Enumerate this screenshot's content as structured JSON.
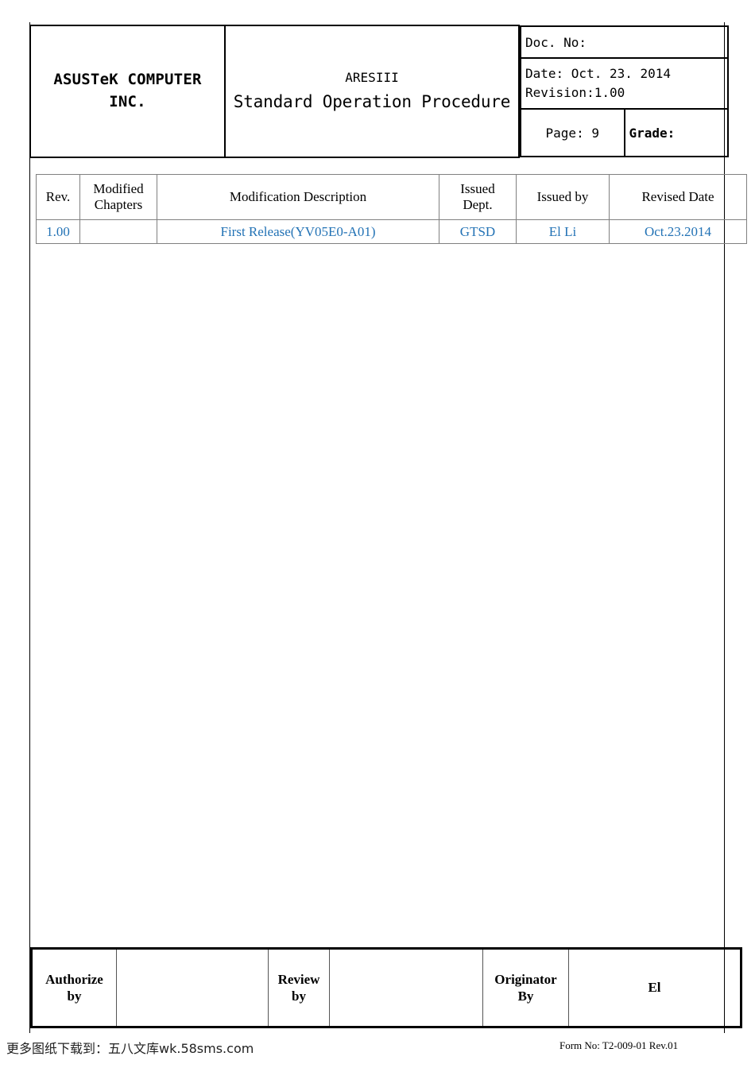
{
  "header": {
    "company": "ASUSTeK COMPUTER\nINC.",
    "company_line1": "ASUSTeK COMPUTER",
    "company_line2": "INC.",
    "product_title": "ARESIII",
    "document_type": "Standard Operation Procedure",
    "doc_no_label": "Doc. No:",
    "doc_no_value": "",
    "date_line": "Date: Oct. 23. 2014",
    "revision_line": "Revision:1.00",
    "page_label": "Page: 9",
    "grade_label": "Grade:",
    "grade_value": ""
  },
  "revision_table": {
    "columns": [
      "Rev.",
      "Modified Chapters",
      "Modification Description",
      "Issued Dept.",
      "Issued by",
      "Revised Date"
    ],
    "columns_split": [
      {
        "line1": "Rev.",
        "line2": ""
      },
      {
        "line1": "Modified",
        "line2": "Chapters"
      },
      {
        "line1": "Modification Description",
        "line2": ""
      },
      {
        "line1": "Issued",
        "line2": "Dept."
      },
      {
        "line1": "Issued by",
        "line2": ""
      },
      {
        "line1": "Revised Date",
        "line2": ""
      }
    ],
    "rows": [
      {
        "rev": "1.00",
        "modified_chapters": "",
        "description": "First Release(YV05E0-A01)",
        "issued_dept": "GTSD",
        "issued_by": "El Li",
        "revised_date": "Oct.23.2014"
      }
    ],
    "row_text_color": "#2272b5",
    "border_color": "#808080"
  },
  "signature_table": {
    "authorize_label": "Authorize by",
    "authorize_label_l1": "Authorize",
    "authorize_label_l2": "by",
    "authorize_value": "",
    "review_label": "Review by",
    "review_label_l1": "Review",
    "review_label_l2": "by",
    "review_value": "",
    "originator_label": "Originator By",
    "originator_label_l1": "Originator",
    "originator_label_l2": "By",
    "originator_value": "El"
  },
  "footer": {
    "watermark": "更多图纸下载到：五八文库wk.58sms.com",
    "form_no": "Form No: T2-009-01 Rev.01"
  }
}
